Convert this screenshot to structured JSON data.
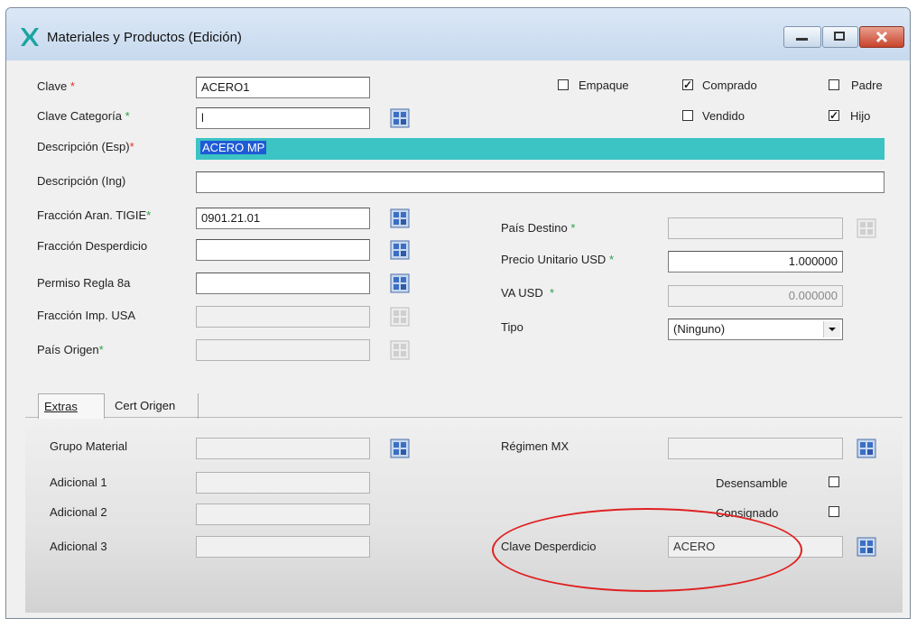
{
  "window": {
    "title": "Materiales y Productos (Edición)"
  },
  "form": {
    "clave": {
      "label": "Clave",
      "value": "ACERO1"
    },
    "clave_categoria": {
      "label": "Clave Categoría",
      "value": "l"
    },
    "descripcion_esp": {
      "label": "Descripción (Esp)",
      "value": "ACERO MP"
    },
    "descripcion_ing": {
      "label": "Descripción (Ing)",
      "value": ""
    },
    "fraccion_aran": {
      "label": "Fracción Aran. TIGIE",
      "value": "0901.21.01"
    },
    "fraccion_desperdicio": {
      "label": "Fracción Desperdicio",
      "value": ""
    },
    "permiso_regla": {
      "label": "Permiso Regla 8a",
      "value": ""
    },
    "fraccion_imp_usa": {
      "label": "Fracción Imp. USA",
      "value": ""
    },
    "pais_origen": {
      "label": "País Origen",
      "value": ""
    },
    "pais_destino": {
      "label": "País Destino",
      "value": ""
    },
    "precio_unitario": {
      "label": "Precio Unitario USD",
      "value": "1.000000"
    },
    "va_usd": {
      "label": "VA USD",
      "value": "0.000000"
    },
    "tipo": {
      "label": "Tipo",
      "value": "(Ninguno)"
    },
    "required_marker": "*"
  },
  "checkboxes": {
    "empaque": {
      "label": "Empaque",
      "checked": false
    },
    "comprado": {
      "label": "Comprado",
      "checked": true
    },
    "padre": {
      "label": "Padre",
      "checked": false
    },
    "vendido": {
      "label": "Vendido",
      "checked": false
    },
    "hijo": {
      "label": "Hijo",
      "checked": true
    },
    "check_glyph": "✓"
  },
  "tabs": [
    {
      "label": "Extras",
      "active": true
    },
    {
      "label": "Cert Origen",
      "active": false
    }
  ],
  "extras": {
    "grupo_material": {
      "label": "Grupo Material",
      "value": ""
    },
    "adicional_1": {
      "label": "Adicional 1",
      "value": ""
    },
    "adicional_2": {
      "label": "Adicional 2",
      "value": ""
    },
    "adicional_3": {
      "label": "Adicional 3",
      "value": ""
    },
    "regimen_mx": {
      "label": "Régimen MX",
      "value": ""
    },
    "desensamble": {
      "label": "Desensamble",
      "checked": false
    },
    "consignado": {
      "label": "Consignado",
      "checked": false
    },
    "clave_desperdicio": {
      "label": "Clave Desperdicio",
      "value": "ACERO"
    }
  },
  "icons": {
    "lookup": "lookup-grid-icon",
    "minimize": "minimize-icon",
    "maximize": "maximize-icon",
    "close": "close-icon",
    "dropdown": "chevron-down-icon",
    "app": "app-logo-icon"
  },
  "colors": {
    "required_red": "#e2342c",
    "required_green": "#2aa148",
    "selection_highlight": "#3cc3c4",
    "annotation": "#e02020"
  }
}
